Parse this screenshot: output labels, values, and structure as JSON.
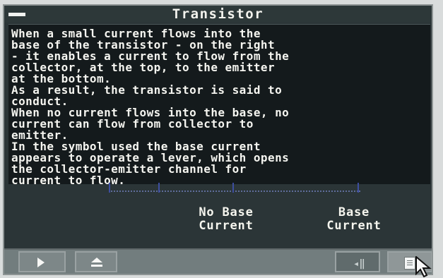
{
  "window": {
    "title": "Transistor"
  },
  "text_lines": [
    "When a small current flows into the",
    "base of the transistor - on the right",
    "- it enables a current to flow from the",
    "collector, at the top, to the emitter",
    "at the bottom.",
    "As a result, the transistor is said to",
    "conduct.",
    "When no current flows into the base, no",
    "current can flow from collector to",
    "emitter.",
    "In the symbol used the base current",
    "appears to operate a lever, which opens",
    "the collector-emitter channel for",
    "current to flow."
  ],
  "captions": {
    "no_base_current": "No Base\nCurrent",
    "base_current": "Base\nCurrent"
  },
  "icons": {
    "close": "close-box-icon",
    "play": "play-icon",
    "eject": "eject-icon",
    "volume": "volume-icon",
    "notes": "notes-icon",
    "cursor": "cursor-icon"
  },
  "colors": {
    "panel": "#141a1c",
    "window": "#2b3537",
    "text": "#f5f5f0",
    "diagram_blue": "#3d4ea0",
    "controls": "#727d7e"
  }
}
